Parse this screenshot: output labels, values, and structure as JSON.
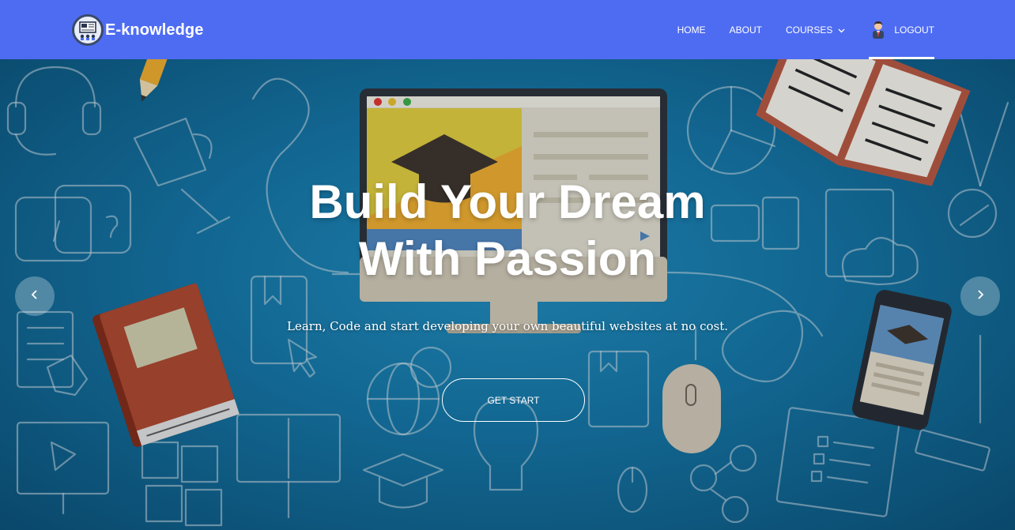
{
  "brand": {
    "name": "E-knowledge",
    "logo_icon": "computer-classroom-logo-icon"
  },
  "nav": {
    "items": [
      {
        "label": "HOME"
      },
      {
        "label": "ABOUT"
      },
      {
        "label": "COURSES",
        "icon": "chevron-down-icon"
      },
      {
        "label": "LOGOUT",
        "icon": "user-avatar-icon",
        "active": true
      }
    ]
  },
  "hero": {
    "title_line1": "Build Your Dream",
    "title_line2": "With Passion",
    "subtitle": "Learn, Code and start developing your own beautiful websites at no cost.",
    "cta_label": "GET START",
    "prev_icon": "chevron-left-icon",
    "next_icon": "chevron-right-icon"
  },
  "colors": {
    "navbar": "#4e6cf2",
    "hero_bg": "#136f9c",
    "text": "#ffffff"
  }
}
